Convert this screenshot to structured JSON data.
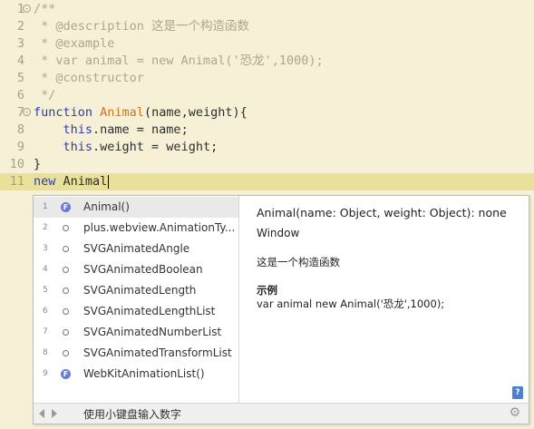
{
  "editor": {
    "lines": [
      {
        "num": "1",
        "fold": "-",
        "parts": [
          {
            "cls": "c-comment",
            "text": "/**"
          }
        ]
      },
      {
        "num": "2",
        "parts": [
          {
            "cls": "c-comment",
            "text": " * @description 这是一个构造函数"
          }
        ]
      },
      {
        "num": "3",
        "parts": [
          {
            "cls": "c-comment",
            "text": " * @example"
          }
        ]
      },
      {
        "num": "4",
        "parts": [
          {
            "cls": "c-comment",
            "text": " * var animal = new Animal('恐龙',1000);"
          }
        ]
      },
      {
        "num": "5",
        "parts": [
          {
            "cls": "c-comment",
            "text": " * @constructor"
          }
        ]
      },
      {
        "num": "6",
        "parts": [
          {
            "cls": "c-comment",
            "text": " */"
          }
        ]
      },
      {
        "num": "7",
        "fold": "-",
        "parts": [
          {
            "cls": "c-keyword",
            "text": "function "
          },
          {
            "cls": "c-name",
            "text": "Animal"
          },
          {
            "cls": "c-plain",
            "text": "(name,weight){"
          }
        ]
      },
      {
        "num": "8",
        "parts": [
          {
            "cls": "c-plain",
            "text": "    "
          },
          {
            "cls": "c-keyword",
            "text": "this"
          },
          {
            "cls": "c-plain",
            "text": ".name = name;"
          }
        ]
      },
      {
        "num": "9",
        "parts": [
          {
            "cls": "c-plain",
            "text": "    "
          },
          {
            "cls": "c-keyword",
            "text": "this"
          },
          {
            "cls": "c-plain",
            "text": ".weight = weight;"
          }
        ]
      },
      {
        "num": "10",
        "parts": [
          {
            "cls": "c-plain",
            "text": "}"
          }
        ]
      },
      {
        "num": "11",
        "current": true,
        "parts": [
          {
            "cls": "c-keyword",
            "text": "new "
          },
          {
            "cls": "c-plain",
            "text": "Animal"
          }
        ]
      }
    ]
  },
  "popup": {
    "items": [
      {
        "idx": "1",
        "kind": "function",
        "badge": "F",
        "label": "Animal()",
        "selected": true
      },
      {
        "idx": "2",
        "kind": "object",
        "label": "plus.webview.AnimationTy..."
      },
      {
        "idx": "3",
        "kind": "object",
        "label": "SVGAnimatedAngle"
      },
      {
        "idx": "4",
        "kind": "object",
        "label": "SVGAnimatedBoolean"
      },
      {
        "idx": "5",
        "kind": "object",
        "label": "SVGAnimatedLength"
      },
      {
        "idx": "6",
        "kind": "object",
        "label": "SVGAnimatedLengthList"
      },
      {
        "idx": "7",
        "kind": "object",
        "label": "SVGAnimatedNumberList"
      },
      {
        "idx": "8",
        "kind": "object",
        "label": "SVGAnimatedTransformList"
      },
      {
        "idx": "9",
        "kind": "function",
        "badge": "F",
        "label": "WebKitAnimationList()"
      }
    ],
    "doc": {
      "signature": "Animal(name: Object, weight: Object): none",
      "owner": "Window",
      "description": "这是一个构造函数",
      "example_heading": "示例",
      "example_code": "var animal new Animal('恐龙',1000);",
      "help_badge": "?"
    },
    "status": {
      "hint": "使用小键盘输入数字",
      "gear_icon": "⚙"
    }
  }
}
